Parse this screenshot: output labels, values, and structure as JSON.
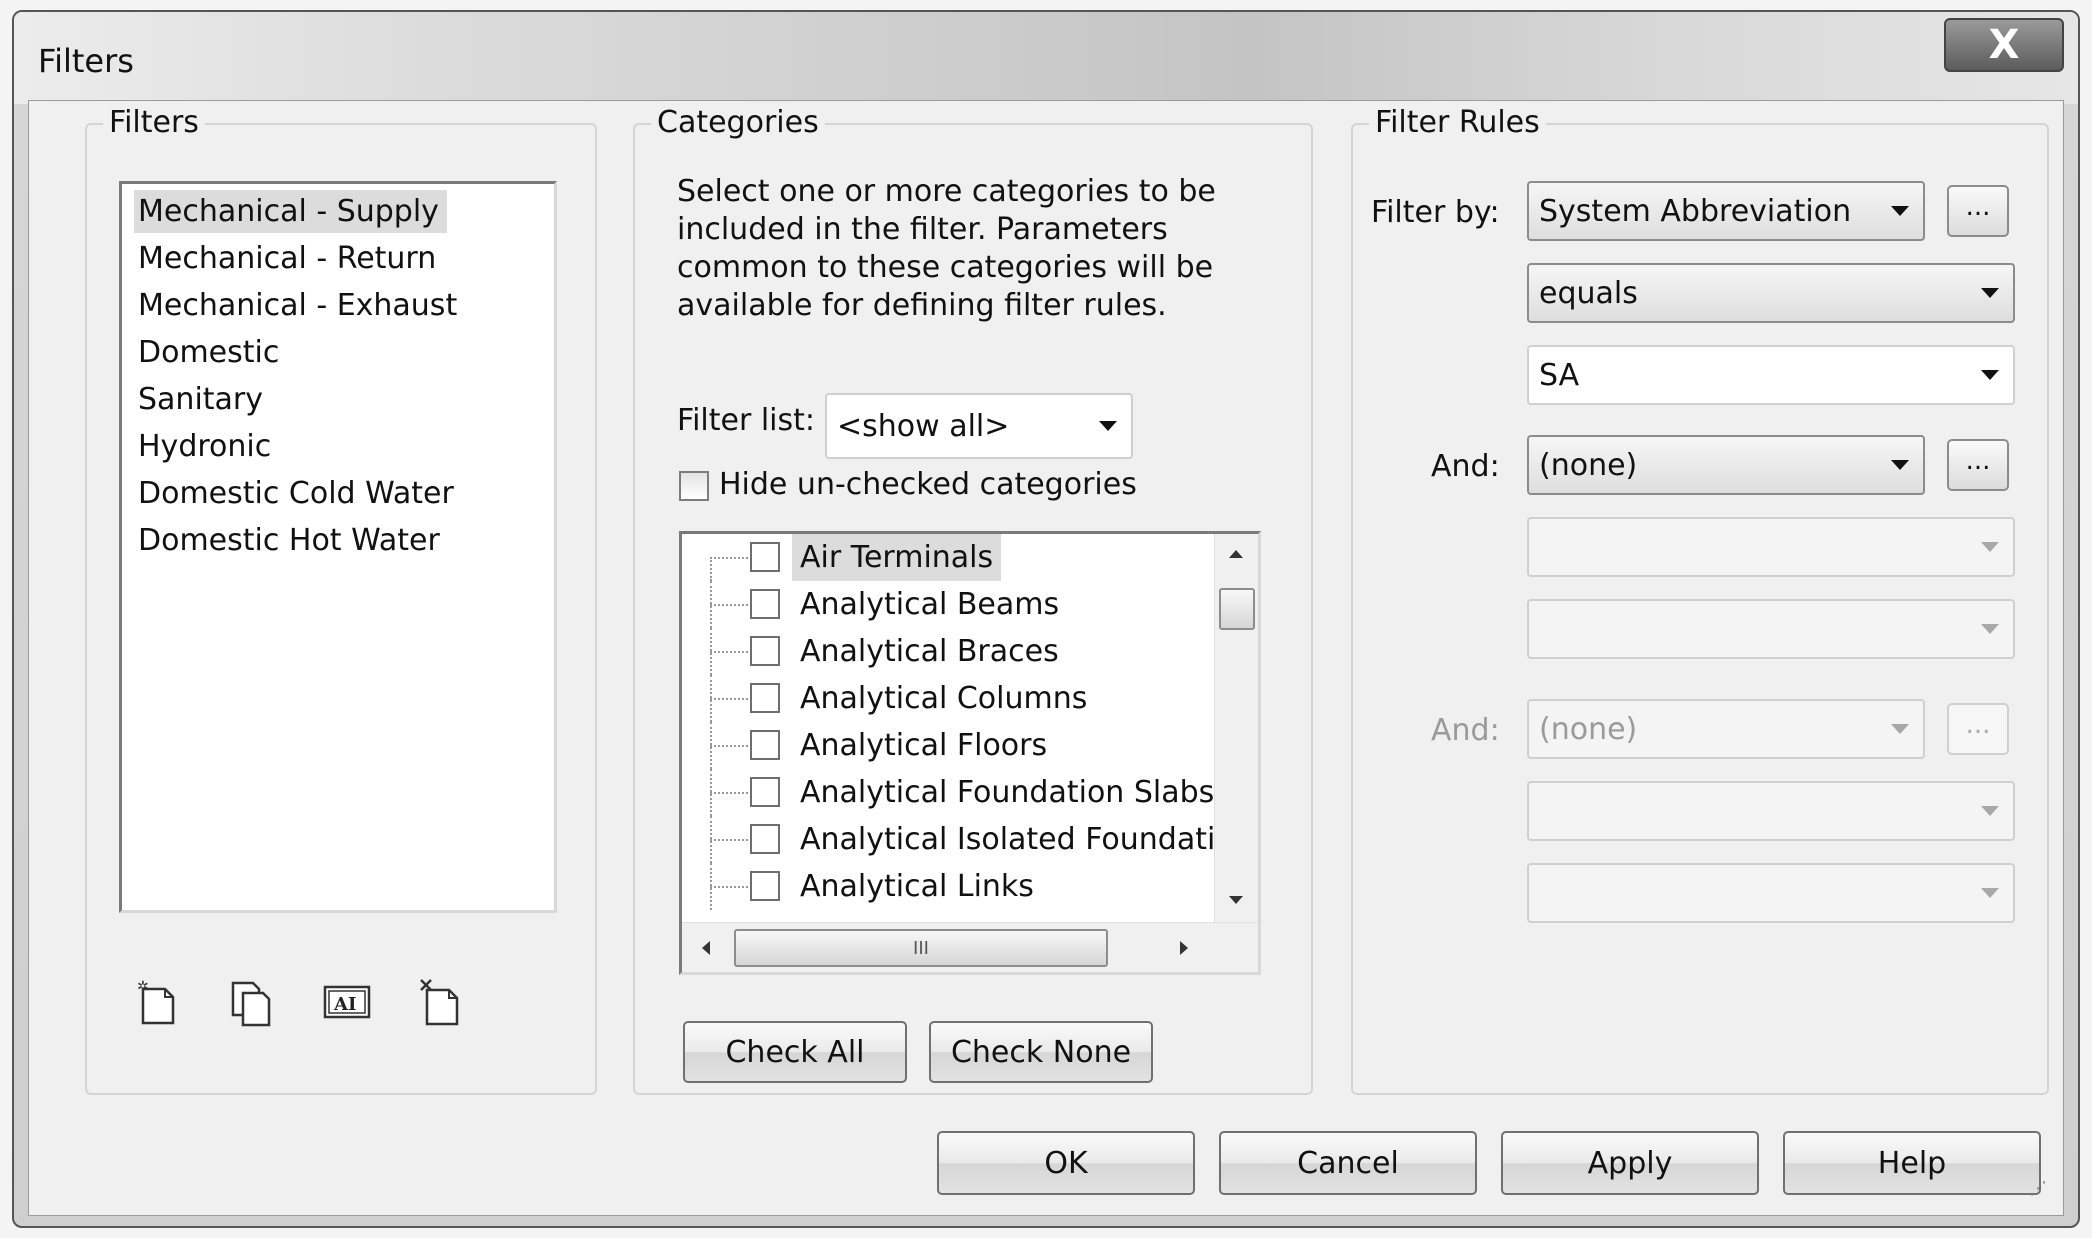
{
  "window": {
    "title": "Filters",
    "close_label": "X"
  },
  "filters_group": {
    "label": "Filters",
    "items": [
      "Mechanical - Supply",
      "Mechanical - Return",
      "Mechanical - Exhaust",
      "Domestic",
      "Sanitary",
      "Hydronic",
      "Domestic Cold Water",
      "Domestic Hot Water"
    ],
    "selected_index": 0,
    "icon_buttons": [
      "new-filter-icon",
      "duplicate-filter-icon",
      "rename-filter-icon",
      "delete-filter-icon"
    ],
    "rename_icon_text": "AI"
  },
  "categories_group": {
    "label": "Categories",
    "description": "Select one or more categories to be included in the filter.  Parameters common to these categories will be available for defining filter rules.",
    "filter_list_label": "Filter list:",
    "filter_list_value": "<show all>",
    "hide_unchecked_label": "Hide un-checked categories",
    "hide_unchecked_checked": false,
    "items": [
      "Air Terminals",
      "Analytical Beams",
      "Analytical Braces",
      "Analytical Columns",
      "Analytical Floors",
      "Analytical Foundation Slabs",
      "Analytical Isolated Foundati..",
      "Analytical Links"
    ],
    "scroll_thumb_text": "III",
    "check_all_label": "Check All",
    "check_none_label": "Check None"
  },
  "filter_rules_group": {
    "label": "Filter Rules",
    "filter_by_label": "Filter by:",
    "rule1": {
      "parameter": "System Abbreviation",
      "operator": "equals",
      "value": "SA"
    },
    "and1_label": "And:",
    "rule2": {
      "parameter": "(none)",
      "operator": "",
      "value": ""
    },
    "and2_label": "And:",
    "rule3": {
      "parameter": "(none)",
      "operator": "",
      "value": ""
    },
    "ellipsis_label": "..."
  },
  "footer": {
    "ok_label": "OK",
    "cancel_label": "Cancel",
    "apply_label": "Apply",
    "help_label": "Help"
  }
}
